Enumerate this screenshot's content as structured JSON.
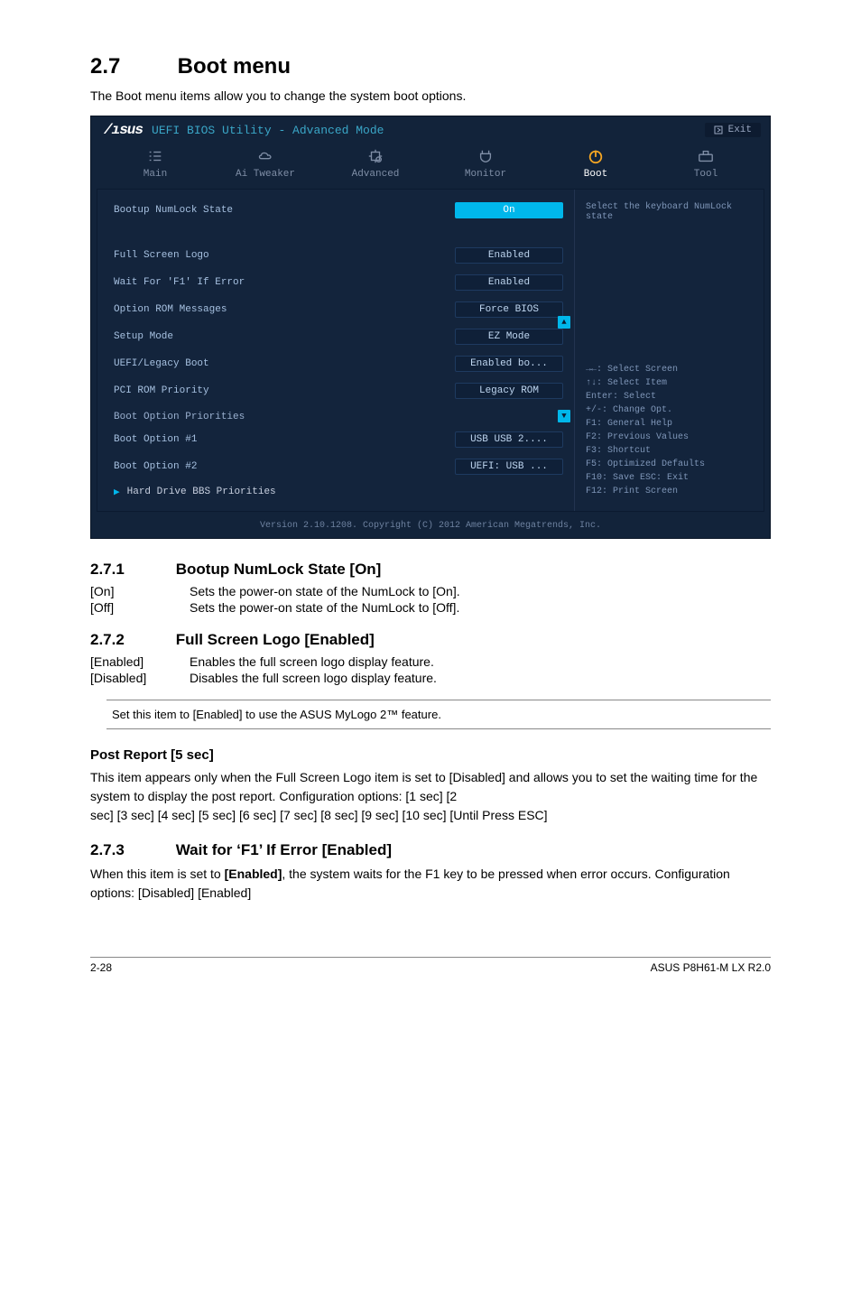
{
  "section": {
    "number": "2.7",
    "title": "Boot menu"
  },
  "intro": "The Boot menu items allow you to change the system boot options.",
  "bios": {
    "brand": "/ISUS",
    "brand_text": "UEFI BIOS Utility - Advanced Mode",
    "exit": "Exit",
    "tabs": [
      "Main",
      "Ai Tweaker",
      "Advanced",
      "Monitor",
      "Boot",
      "Tool"
    ],
    "active_tab": 4,
    "help_top": "Select the keyboard NumLock state",
    "rows": [
      {
        "label": "Bootup NumLock State",
        "value": "On",
        "selected": true
      },
      {
        "label": "Full Screen Logo",
        "value": "Enabled"
      },
      {
        "label": "Wait For 'F1' If Error",
        "value": "Enabled"
      },
      {
        "label": "Option ROM Messages",
        "value": "Force BIOS"
      },
      {
        "label": "Setup Mode",
        "value": "EZ Mode"
      },
      {
        "label": "UEFI/Legacy Boot",
        "value": "Enabled bo..."
      },
      {
        "label": "PCI ROM Priority",
        "value": "Legacy ROM"
      }
    ],
    "priorities_header": "Boot Option Priorities",
    "priorities": [
      {
        "label": "Boot Option #1",
        "value": "USB USB 2...."
      },
      {
        "label": "Boot Option #2",
        "value": "UEFI: USB ..."
      }
    ],
    "hd_row": "Hard Drive BBS Priorities",
    "help_bot": [
      "→←: Select Screen",
      "↑↓: Select Item",
      "Enter: Select",
      "+/-: Change Opt.",
      "F1: General Help",
      "F2: Previous Values",
      "F3: Shortcut",
      "F5: Optimized Defaults",
      "F10: Save  ESC: Exit",
      "F12: Print Screen"
    ],
    "footer": "Version 2.10.1208. Copyright (C) 2012 American Megatrends, Inc."
  },
  "s271": {
    "num": "2.7.1",
    "title": "Bootup NumLock State [On]",
    "opts": [
      {
        "k": "[On]",
        "v": "Sets the power-on state of the NumLock to [On]."
      },
      {
        "k": "[Off]",
        "v": "Sets the power-on state of the NumLock to [Off]."
      }
    ]
  },
  "s272": {
    "num": "2.7.2",
    "title": "Full Screen Logo [Enabled]",
    "opts": [
      {
        "k": "[Enabled]",
        "v": "Enables the full screen logo display feature."
      },
      {
        "k": "[Disabled]",
        "v": "Disables the full screen logo display feature."
      }
    ]
  },
  "note": "Set this item to [Enabled] to use the ASUS MyLogo 2™ feature.",
  "post": {
    "title": "Post Report [5 sec]",
    "body1": "This item appears only when the Full Screen Logo item is set to [Disabled] and allows you to set the waiting time for the system to display the post report. Configuration options: [1 sec] [2",
    "body2": "sec] [3 sec] [4 sec] [5 sec] [6 sec] [7 sec] [8 sec] [9 sec] [10 sec] [Until Press ESC]"
  },
  "s273": {
    "num": "2.7.3",
    "title": "Wait for ‘F1’ If Error [Enabled]",
    "body_a": "When this item is set to ",
    "body_b": "[Enabled]",
    "body_c": ", the system waits for the F1 key to be pressed when error occurs. Configuration options: [Disabled] [Enabled]"
  },
  "footer": {
    "left": "2-28",
    "right": "ASUS P8H61-M LX R2.0"
  }
}
